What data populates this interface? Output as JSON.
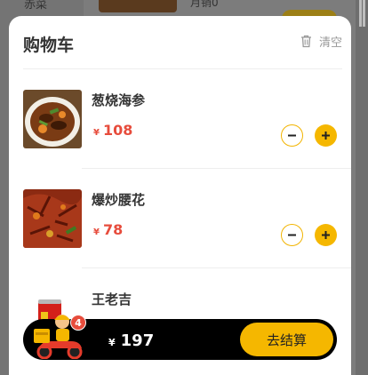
{
  "background": {
    "side_label": "赤菜",
    "text": "月销0"
  },
  "cart": {
    "title": "购物车",
    "clear_label": "清空",
    "currency": "¥",
    "items": [
      {
        "name": "葱烧海参",
        "price": "108",
        "image": "sea-cucumber-dish"
      },
      {
        "name": "爆炒腰花",
        "price": "78",
        "image": "stir-fried-kidney-dish"
      },
      {
        "name": "王老吉",
        "price": "",
        "image": "herbal-tea-can"
      }
    ]
  },
  "bottom_bar": {
    "badge_count": "4",
    "currency": "¥",
    "total": "197",
    "checkout_label": "去结算",
    "icon": "delivery-rider-icon"
  },
  "colors": {
    "accent": "#f5b700",
    "price": "#e74c3c",
    "bar": "#000000"
  }
}
